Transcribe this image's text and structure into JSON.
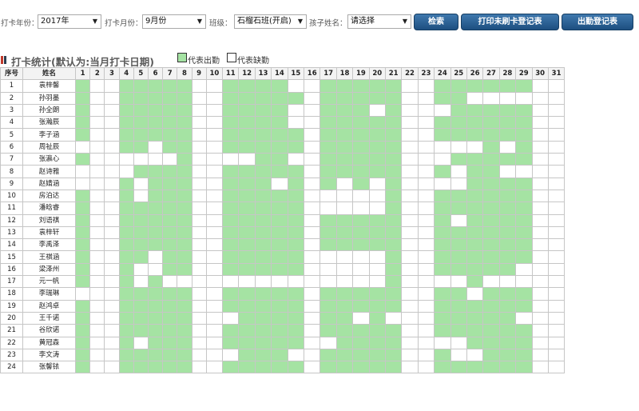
{
  "filters": {
    "year_label": "打卡年份：",
    "year_value": "2017年",
    "month_label": "打卡月份：",
    "month_value": "9月份",
    "class_label": "班级：",
    "class_value": "石榴石班(开启)",
    "child_label": "孩子姓名：",
    "child_value": "请选择",
    "dropdown_icon": "triangle-down"
  },
  "buttons": {
    "search": "检索",
    "print_unpunched": "打印未刷卡登记表",
    "attendance_register": "出勤登记表"
  },
  "section": {
    "title": "打卡统计(默认为:当月打卡日期)",
    "legend_present": "代表出勤",
    "legend_absent": "代表缺勤",
    "present_color": "#a5e3a3",
    "absent_color": "#ffffff",
    "title_bar_colors": [
      "#c0392b",
      "#2c3e50"
    ]
  },
  "table": {
    "col_index": "序号",
    "col_name": "姓名",
    "days": [
      "1",
      "2",
      "3",
      "4",
      "5",
      "6",
      "7",
      "8",
      "9",
      "10",
      "11",
      "12",
      "13",
      "14",
      "15",
      "16",
      "17",
      "18",
      "19",
      "20",
      "21",
      "22",
      "23",
      "24",
      "25",
      "26",
      "27",
      "28",
      "29",
      "30",
      "31"
    ],
    "rows": [
      {
        "no": "1",
        "name": "袁梓馨",
        "att": "1001111100111100111110011111100"
      },
      {
        "no": "2",
        "name": "孙羽墨",
        "att": "1001111100111110111110011000000"
      },
      {
        "no": "3",
        "name": "孙全朗",
        "att": "1001111100111100111010001111100"
      },
      {
        "no": "4",
        "name": "张瀚辰",
        "att": "1001111100111100111110011111100"
      },
      {
        "no": "5",
        "name": "李子涵",
        "att": "1001111100111110111110011111100"
      },
      {
        "no": "6",
        "name": "周祉辰",
        "att": "0001101100111110111110000010100"
      },
      {
        "no": "7",
        "name": "张瀛心",
        "att": "1000000100001100111110001111100"
      },
      {
        "no": "8",
        "name": "赵诗雅",
        "att": "0000111100111110111110010110000"
      },
      {
        "no": "9",
        "name": "赵婧涵",
        "att": "0001011100111010101010000111100"
      },
      {
        "no": "10",
        "name": "房泊达",
        "att": "1001011100111110000010011111100"
      },
      {
        "no": "11",
        "name": "潘晗睿",
        "att": "1001111100111110000010011111100"
      },
      {
        "no": "12",
        "name": "刘语祺",
        "att": "1001111100111110111110010111100"
      },
      {
        "no": "13",
        "name": "袁梓轩",
        "att": "1001111100111110111110011111100"
      },
      {
        "no": "14",
        "name": "李禹泽",
        "att": "1001111100111110111110011111100"
      },
      {
        "no": "15",
        "name": "王祺涵",
        "att": "1001101100111110000010011111100"
      },
      {
        "no": "16",
        "name": "梁泽州",
        "att": "1001001100111110000010011111000"
      },
      {
        "no": "17",
        "name": "元一帆",
        "att": "1001010000000000000010000100000"
      },
      {
        "no": "18",
        "name": "李瑞琳",
        "att": "0001111100111110111110011011100"
      },
      {
        "no": "19",
        "name": "赵鸿卓",
        "att": "1001111100111110111110011111100"
      },
      {
        "no": "20",
        "name": "王千诺",
        "att": "1001111100011110110100011111000"
      },
      {
        "no": "21",
        "name": "谷欣诺",
        "att": "1001111100111110111110011111100"
      },
      {
        "no": "22",
        "name": "黄冠森",
        "att": "1001011100111110011110000111100"
      },
      {
        "no": "23",
        "name": "李文涛",
        "att": "1001111100011100111110010011100"
      },
      {
        "no": "24",
        "name": "张馨铱",
        "att": "1001111100111110111110011111100"
      }
    ]
  }
}
